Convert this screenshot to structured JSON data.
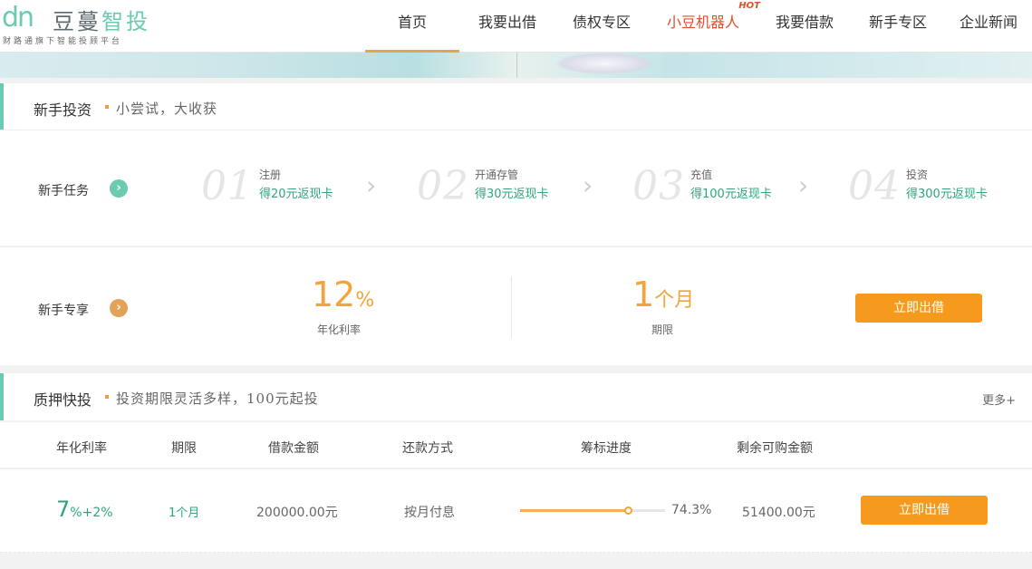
{
  "logo": {
    "mark": "dn",
    "name_a": "豆蔓",
    "name_b": "智投",
    "slogan": "财路通旗下智能投顾平台"
  },
  "nav": [
    {
      "label": "首页",
      "active": true
    },
    {
      "label": "我要出借"
    },
    {
      "label": "债权专区"
    },
    {
      "label": "小豆机器人",
      "badge": "HOT"
    },
    {
      "label": "我要借款"
    },
    {
      "label": "新手专区"
    },
    {
      "label": "企业新闻"
    }
  ],
  "newbie": {
    "title": "新手投资",
    "subtitle": "小尝试，大收获",
    "task_label": "新手任务",
    "steps": [
      {
        "num": "01",
        "name": "注册",
        "reward": "得20元返现卡"
      },
      {
        "num": "02",
        "name": "开通存管",
        "reward": "得30元返现卡"
      },
      {
        "num": "03",
        "name": "充值",
        "reward": "得100元返现卡"
      },
      {
        "num": "04",
        "name": "投资",
        "reward": "得300元返现卡"
      }
    ],
    "exclusive_label": "新手专享",
    "rate_value": "12",
    "rate_unit": "%",
    "rate_caption": "年化利率",
    "term_value": "1",
    "term_unit": "个月",
    "term_caption": "期限",
    "button": "立即出借"
  },
  "pledge": {
    "title": "质押快投",
    "subtitle": "投资期限灵活多样，100元起投",
    "more": "更多+",
    "columns": [
      "年化利率",
      "期限",
      "借款金额",
      "还款方式",
      "筹标进度",
      "剩余可购金额"
    ],
    "rows": [
      {
        "rate": "7",
        "rate_suffix": "%+2%",
        "term": "1个月",
        "amount": "200000.00元",
        "repay": "按月付息",
        "progress": 74.3,
        "progress_text": "74.3%",
        "remaining": "51400.00元",
        "button": "立即出借"
      }
    ]
  },
  "colors": {
    "brand_green": "#6cc9b2",
    "accent_orange": "#f59a1c",
    "rate_orange": "#f2a43a",
    "reward_green": "#2fa57b",
    "hot_red": "#e04f2c"
  }
}
